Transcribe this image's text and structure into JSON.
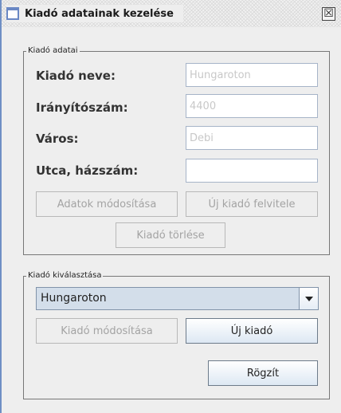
{
  "window": {
    "title": "Kiadó adatainak kezelése",
    "close_glyph": "☒"
  },
  "publisher_data": {
    "group_title": "Kiadó adatai",
    "name_label": "Kiadó neve:",
    "name_value": "Hungaroton",
    "zip_label": "Irányítószám:",
    "zip_value": "4400",
    "city_label": "Város:",
    "city_value": "Debi",
    "street_label": "Utca, házszám:",
    "street_value": "",
    "modify_data_button": "Adatok módosítása",
    "add_publisher_button": "Új kiadó felvitele",
    "delete_publisher_button": "Kiadó törlése"
  },
  "publisher_select": {
    "group_title": "Kiadó kiválasztása",
    "selected": "Hungaroton",
    "modify_publisher_button": "Kiadó módosítása",
    "new_publisher_button": "Új kiadó",
    "save_button": "Rögzít"
  },
  "icons": [
    "window-icon",
    "close-icon",
    "chevron-down-icon"
  ]
}
